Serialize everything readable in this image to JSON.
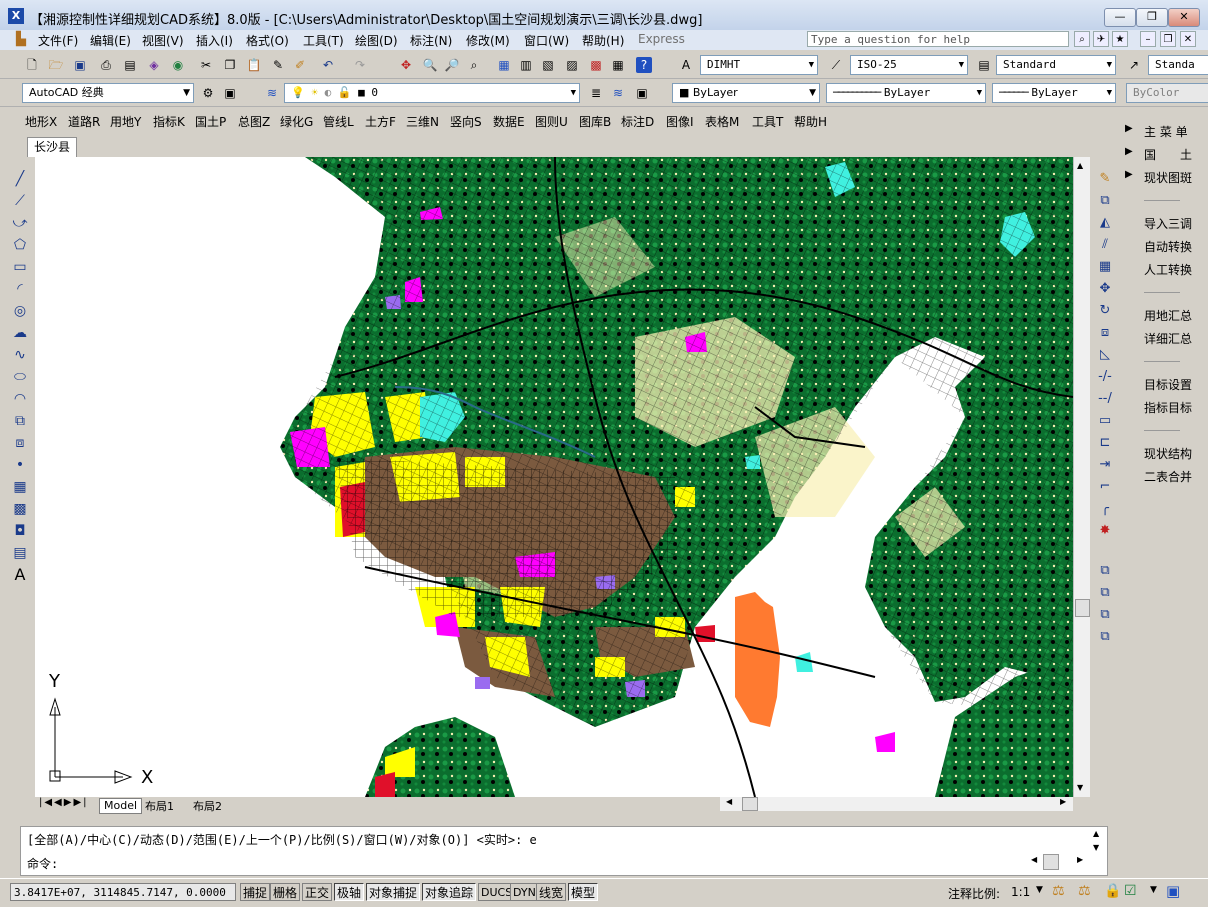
{
  "window": {
    "title": "【湘源控制性详细规划CAD系统】8.0版 - [C:\\Users\\Administrator\\Desktop\\国土空间规划演示\\三调\\长沙县.dwg]",
    "app_icon_label": "X",
    "min": "—",
    "restore": "❐",
    "close": "✕"
  },
  "menubar": {
    "items": [
      "文件(F)",
      "编辑(E)",
      "视图(V)",
      "插入(I)",
      "格式(O)",
      "工具(T)",
      "绘图(D)",
      "标注(N)",
      "修改(M)",
      "窗口(W)",
      "帮助(H)",
      "Express"
    ],
    "help_placeholder": "Type a question for help"
  },
  "toolbar1": {
    "dimstyle": "DIMHT",
    "dimstyle2": "ISO-25",
    "textstyle": "Standard",
    "tablestyle": "Standa"
  },
  "toolbar2": {
    "workspace": "AutoCAD 经典",
    "layer": "0",
    "color": "ByLayer",
    "linetype": "ByLayer",
    "lineweight": "ByLayer",
    "plotstyle": "ByColor"
  },
  "custom_menu": [
    "地形X",
    "道路R",
    "用地Y",
    "指标K",
    "国土P",
    "总图Z",
    "绿化G",
    "管线L",
    "土方F",
    "三维N",
    "竖向S",
    "数据E",
    "图则U",
    "图库B",
    "标注D",
    "图像I",
    "表格M",
    "工具T",
    "帮助H"
  ],
  "doc_tab": "长沙县",
  "layout_tabs": [
    "Model",
    "布局1",
    "布局2"
  ],
  "ucs": {
    "x": "X",
    "y": "Y"
  },
  "right_panel": {
    "items": [
      "主 菜 单",
      "国　　土",
      "现状图斑",
      "导入三调",
      "自动转换",
      "人工转换",
      "用地汇总",
      "详细汇总",
      "目标设置",
      "指标目标",
      "现状结构",
      "二表合并"
    ]
  },
  "command": {
    "history": "[全部(A)/中心(C)/动态(D)/范围(E)/上一个(P)/比例(S)/窗口(W)/对象(O)] <实时>: e",
    "prompt": "命令:"
  },
  "statusbar": {
    "coords": "3.8417E+07, 3114845.7147, 0.0000",
    "toggles": [
      "捕捉",
      "栅格",
      "正交",
      "极轴",
      "对象捕捉",
      "对象追踪",
      "DUCS",
      "DYN",
      "线宽",
      "模型"
    ],
    "toggles_on": [
      false,
      false,
      false,
      true,
      true,
      true,
      false,
      false,
      false,
      true
    ],
    "annotation_scale_label": "注释比例:",
    "annotation_scale": "1:1"
  },
  "colors": {
    "forest": "#0b6e2e",
    "forest_light": "#1aa84a",
    "road": "#000000",
    "farmland": "#f8f0b4",
    "residential": "#ffff00",
    "commercial": "#ff00ff",
    "industrial": "#7b5a3f",
    "water": "#40f0e0",
    "public": "#e0102a",
    "airport": "#ff7a30",
    "purple": "#9a6cf0"
  }
}
